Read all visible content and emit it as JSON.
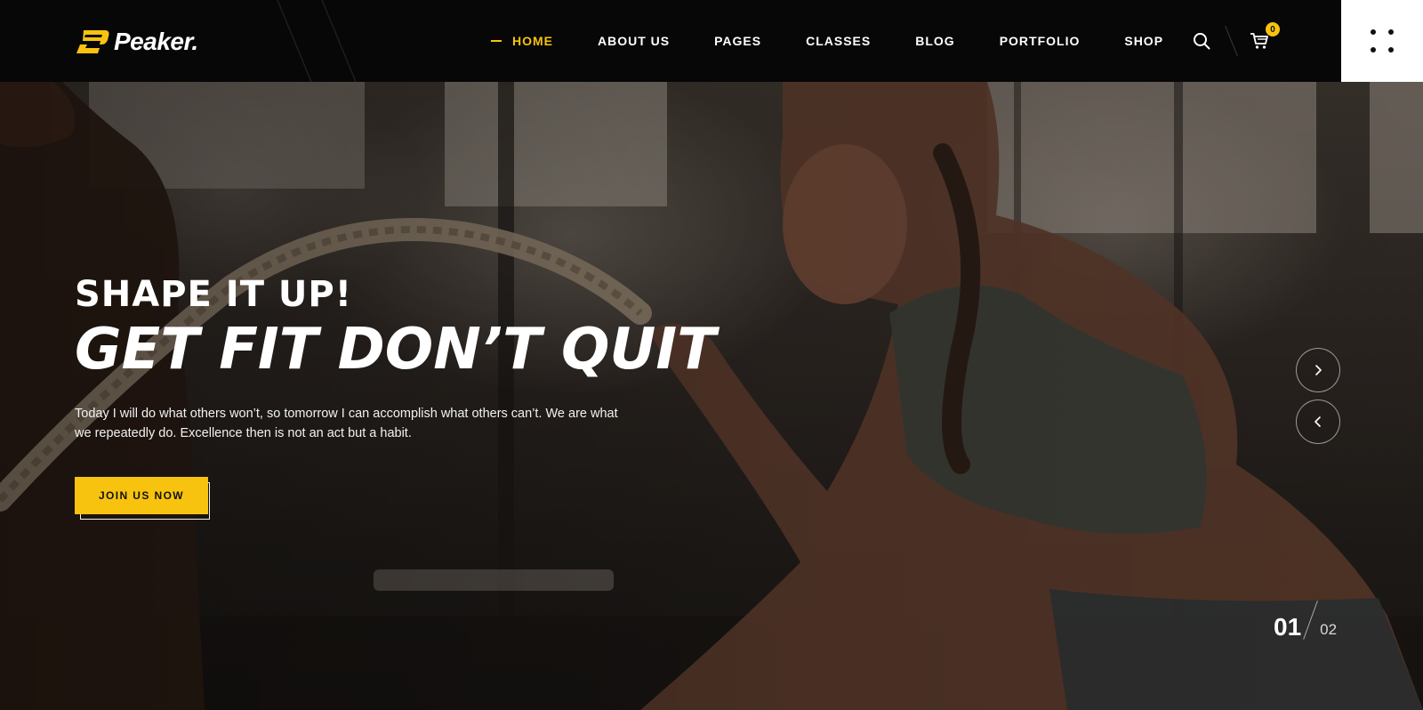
{
  "brand": {
    "name": "Peaker.",
    "accent": "#f7c30f"
  },
  "nav": {
    "items": [
      {
        "label": "HOME",
        "active": true
      },
      {
        "label": "ABOUT US",
        "active": false
      },
      {
        "label": "PAGES",
        "active": false
      },
      {
        "label": "CLASSES",
        "active": false
      },
      {
        "label": "BLOG",
        "active": false
      },
      {
        "label": "PORTFOLIO",
        "active": false
      },
      {
        "label": "SHOP",
        "active": false
      }
    ]
  },
  "tools": {
    "search_icon": "search-icon",
    "cart_icon": "cart-icon",
    "cart_count": "0",
    "menu_icon": "dots-grid-icon"
  },
  "hero": {
    "kicker": "SHAPE IT UP!",
    "title": "GET FIT DON’T QUIT",
    "description": "Today I will do what others won’t, so tomorrow I can accomplish what others can’t. We are what we repeatedly do. Excellence then is not an act but a habit.",
    "cta_label": "JOIN US NOW",
    "next_icon": "chevron-right-icon",
    "prev_icon": "chevron-left-icon"
  },
  "slider": {
    "current": "01",
    "total": "02"
  }
}
